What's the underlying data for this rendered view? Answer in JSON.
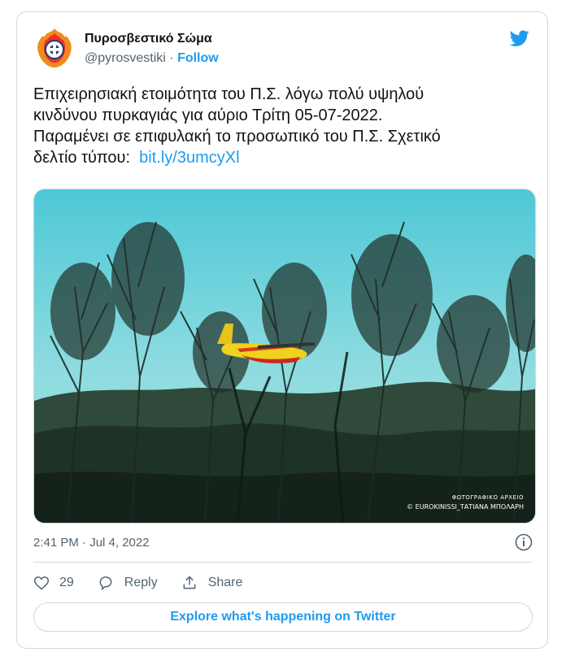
{
  "tweet": {
    "author": {
      "name": "Πυροσβεστικό Σώμα",
      "handle": "@pyrosvestiki",
      "separator": "·",
      "follow_label": "Follow",
      "avatar_icon": "fire-service-emblem-icon"
    },
    "brand_icon": "twitter-bird-icon",
    "text_lines": [
      "Επιχειρησιακή ετοιμότητα του Π.Σ. λόγω πολύ υψηλού",
      "κινδύνου πυρκαγιάς για αύριο Τρίτη  05-07-2022.",
      "Παραμένει σε επιφυλακή το προσωπικό του Π.Σ. Σχετικό",
      "δελτίο τύπου:"
    ],
    "link": "bit.ly/3umcyXl",
    "photo": {
      "credit_line1": "ΦΩΤΟΓΡΑΦΙΚΟ ΑΡΧΕΙΟ",
      "credit_line2": "© EUROKINISSI_ΤΑΤΙΑΝΑ ΜΠΟΛΑΡΗ"
    },
    "timestamp": "2:41 PM · Jul 4, 2022",
    "info_icon": "info-icon",
    "actions": {
      "like_count": "29",
      "reply_label": "Reply",
      "share_label": "Share"
    },
    "explore_label": "Explore what's happening on Twitter"
  },
  "colors": {
    "accent": "#1d9bf0",
    "text_primary": "#0f1419",
    "text_secondary": "#536471",
    "border": "#cfd9de"
  }
}
